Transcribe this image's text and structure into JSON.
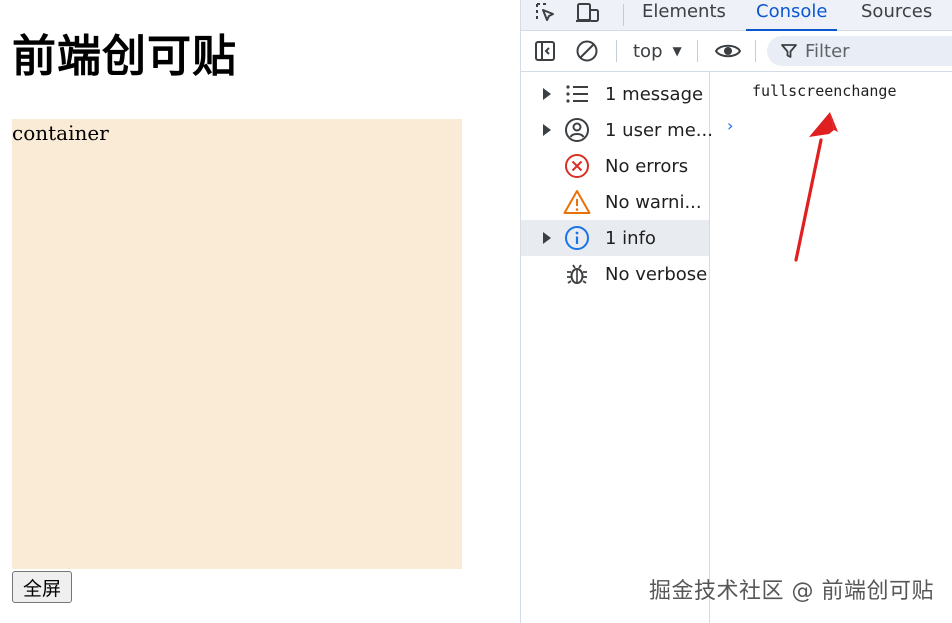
{
  "page": {
    "title": "前端创可贴",
    "container_label": "container",
    "button_label": "全屏",
    "container_color": "#faebd7"
  },
  "devtools": {
    "tabs": [
      {
        "label": "Elements",
        "active": false
      },
      {
        "label": "Console",
        "active": true
      },
      {
        "label": "Sources",
        "active": false
      }
    ],
    "toolbar": {
      "context": "top",
      "filter_placeholder": "Filter"
    },
    "sidebar": [
      {
        "label": "1 message",
        "icon": "list-icon",
        "expandable": true,
        "selected": false
      },
      {
        "label": "1 user me...",
        "icon": "user-icon",
        "expandable": true,
        "selected": false
      },
      {
        "label": "No errors",
        "icon": "error-icon",
        "expandable": false,
        "selected": false
      },
      {
        "label": "No warni...",
        "icon": "warning-icon",
        "expandable": false,
        "selected": false
      },
      {
        "label": "1 info",
        "icon": "info-icon",
        "expandable": true,
        "selected": true
      },
      {
        "label": "No verbose",
        "icon": "bug-icon",
        "expandable": false,
        "selected": false
      }
    ],
    "console_output": "fullscreenchange",
    "accent_color": "#0b57d0"
  },
  "watermark": "掘金技术社区 @ 前端创可贴"
}
